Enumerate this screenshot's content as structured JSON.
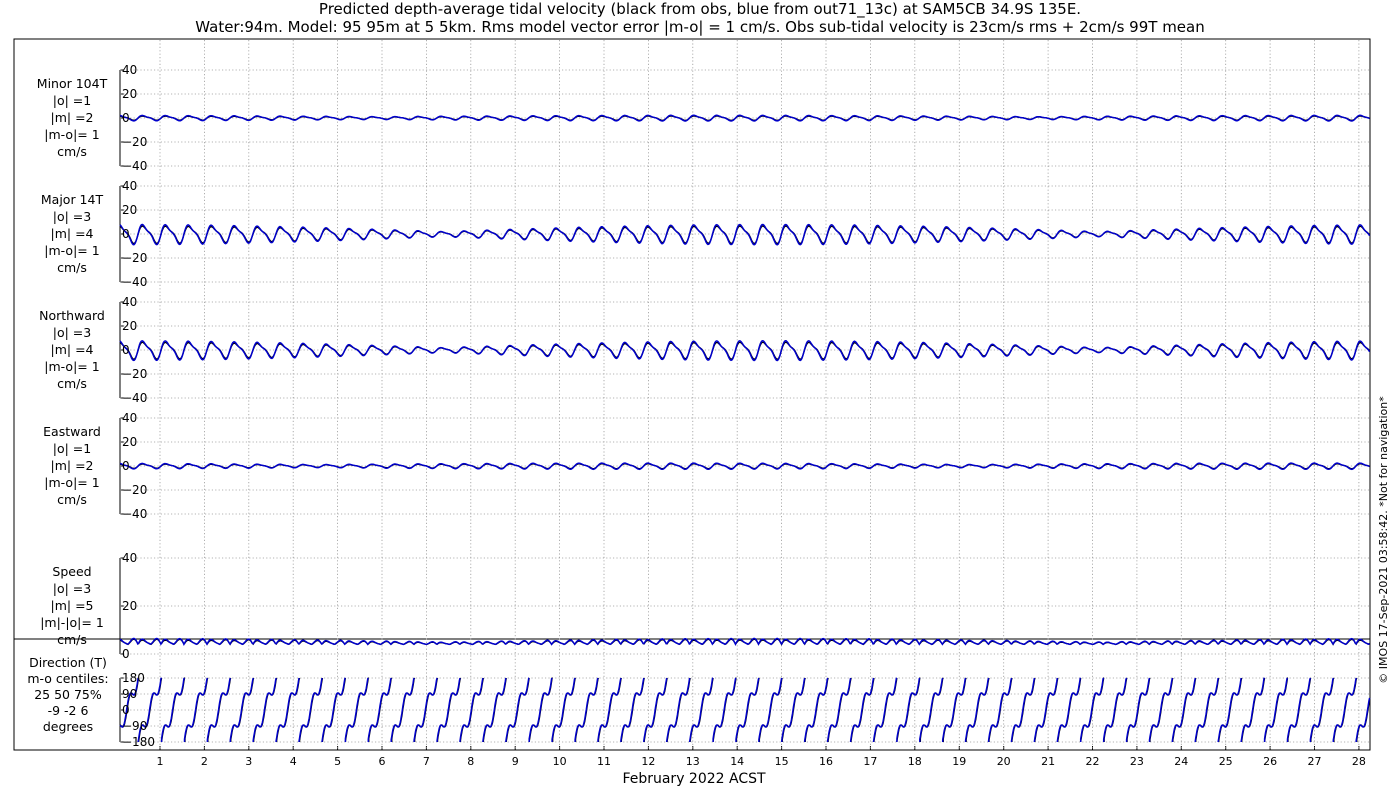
{
  "title_line1": "Predicted depth-average tidal velocity (black from obs, blue from out71_13c) at SAM5CB 34.9S 135E.",
  "title_line2": "Water:94m. Model: 95 95m at 5 5km. Rms model vector error |m-o| = 1 cm/s. Obs sub-tidal velocity is 23cm/s rms + 2cm/s 99T mean",
  "side_note": "© IMOS 17-Sep-2021 03:58:42. *Not for navigation*",
  "colors": {
    "obs": "#000000",
    "model": "#0000cc",
    "grid": "#9a9a9a"
  },
  "chart_data": {
    "type": "line",
    "xlabel": "February 2022 ACST",
    "x_ticks": [
      "1",
      "2",
      "3",
      "4",
      "5",
      "6",
      "7",
      "8",
      "9",
      "10",
      "11",
      "12",
      "13",
      "14",
      "15",
      "16",
      "17",
      "18",
      "19",
      "20",
      "21",
      "22",
      "23",
      "24",
      "25",
      "26",
      "27",
      "28"
    ],
    "x_range_days": [
      0.1,
      28.25
    ],
    "series_names": [
      "obs",
      "out71_13c"
    ],
    "panels": [
      {
        "label_lines": [
          "Minor 104T",
          "|o| =1",
          "|m| =2",
          "|m-o|= 1",
          "cm/s"
        ],
        "ylim": [
          -40,
          40
        ],
        "yticks": [
          "40",
          "20",
          "0",
          "−20",
          "−40"
        ],
        "grid": true,
        "params": {
          "amp_obs": 1.6,
          "amp_model": 2.1,
          "mod_depth": 0.5,
          "mod_phase": 0.3,
          "offset": 0
        }
      },
      {
        "label_lines": [
          "Major 14T",
          "|o| =3",
          "|m| =4",
          "|m-o|= 1",
          "cm/s"
        ],
        "ylim": [
          -40,
          40
        ],
        "yticks": [
          "40",
          "20",
          "0",
          "−20",
          "−40"
        ],
        "grid": true,
        "params": {
          "amp_obs": 6.5,
          "amp_model": 7.5,
          "mod_depth": 0.75,
          "mod_phase": 0.0,
          "offset": 0
        }
      },
      {
        "label_lines": [
          "Northward",
          "|o| =3",
          "|m| =4",
          "|m-o|= 1",
          "cm/s"
        ],
        "ylim": [
          -40,
          40
        ],
        "yticks": [
          "40",
          "20",
          "0",
          "−20",
          "−40"
        ],
        "grid": true,
        "params": {
          "amp_obs": 6.3,
          "amp_model": 7.3,
          "mod_depth": 0.75,
          "mod_phase": 0.0,
          "offset": 0
        }
      },
      {
        "label_lines": [
          "Eastward",
          "|o| =1",
          "|m| =2",
          "|m-o|= 1",
          "cm/s"
        ],
        "ylim": [
          -40,
          40
        ],
        "yticks": [
          "40",
          "20",
          "0",
          "−20",
          "−40"
        ],
        "grid": true,
        "params": {
          "amp_obs": 1.8,
          "amp_model": 2.3,
          "mod_depth": 0.5,
          "mod_phase": 0.6,
          "offset": 0
        }
      },
      {
        "label_lines": [
          "Speed",
          "|o| =3",
          "|m| =5",
          "|m|-|o|= 1",
          "cm/s"
        ],
        "ylim": [
          0,
          40
        ],
        "yticks": [
          "40",
          "20",
          "0"
        ],
        "grid": true,
        "params": {
          "amp_obs": 2.2,
          "amp_model": 2.6,
          "mod_depth": 0.6,
          "mod_phase": 0.0,
          "offset": 4
        }
      }
    ],
    "direction_panel": {
      "label_lines": [
        "Direction (T)",
        "m-o centiles:",
        "25  50  75%",
        "-9  -2  6",
        "degrees"
      ],
      "ylim": [
        -180,
        180
      ],
      "yticks": [
        "180",
        "90",
        "0",
        "−90",
        "−180"
      ]
    }
  }
}
